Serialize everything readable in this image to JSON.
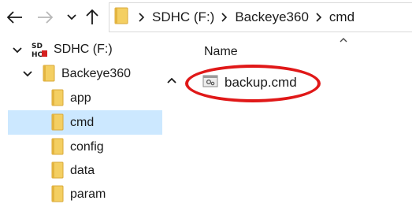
{
  "address_bar": {
    "crumbs": [
      "SDHC (F:)",
      "Backeye360",
      "cmd"
    ]
  },
  "nav_tree": {
    "items": [
      {
        "label": "SDHC (F:)",
        "icon": "sd-card-drive-icon",
        "expanded": true,
        "selected": false
      },
      {
        "label": "Backeye360",
        "icon": "folder-icon",
        "expanded": true,
        "selected": false
      },
      {
        "label": "app",
        "icon": "folder-icon",
        "selected": false
      },
      {
        "label": "cmd",
        "icon": "folder-icon",
        "selected": true
      },
      {
        "label": "config",
        "icon": "folder-icon",
        "selected": false
      },
      {
        "label": "data",
        "icon": "folder-icon",
        "selected": false
      },
      {
        "label": "param",
        "icon": "folder-icon",
        "selected": false
      }
    ]
  },
  "content": {
    "column_header": "Name",
    "sort": "ascending",
    "files": [
      {
        "name": "backup.cmd",
        "icon": "cmd-script-file-icon",
        "highlighted": true
      }
    ]
  },
  "colors": {
    "selection": "#cce8ff",
    "folder": "#f4cf62",
    "highlight_ring": "#e01818"
  },
  "icons": {
    "back": "arrow-left-icon",
    "forward": "arrow-right-icon",
    "recent": "chevron-down-icon",
    "up": "arrow-up-icon",
    "separator": "chevron-right-icon"
  }
}
